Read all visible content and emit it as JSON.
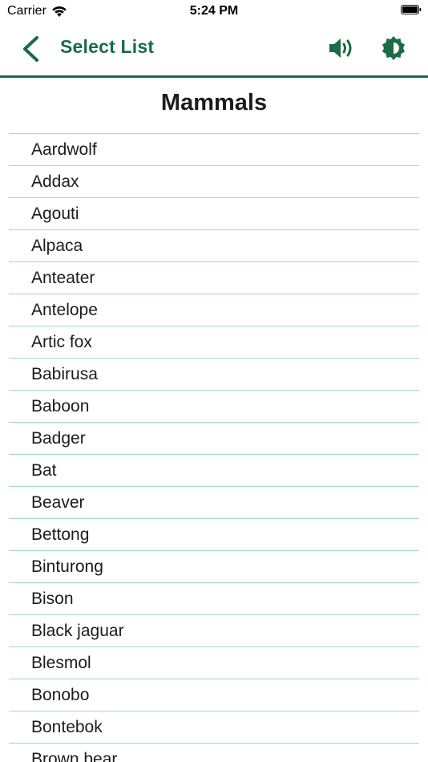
{
  "status_bar": {
    "carrier": "Carrier",
    "time": "5:24 PM"
  },
  "nav": {
    "title": "Select List",
    "back_icon": "chevron-left-icon",
    "speaker_icon": "speaker-icon",
    "theme_icon": "theme-contrast-icon"
  },
  "header": {
    "title": "Mammals"
  },
  "list": {
    "items": [
      "Aardwolf",
      "Addax",
      "Agouti",
      "Alpaca",
      "Anteater",
      "Antelope",
      "Artic fox",
      "Babirusa",
      "Baboon",
      "Badger",
      "Bat",
      "Beaver",
      "Bettong",
      "Binturong",
      "Bison",
      "Black jaguar",
      "Blesmol",
      "Bonobo",
      "Bontebok",
      "Brown bear"
    ]
  },
  "colors": {
    "accent": "#1a6b46",
    "divider": "#9edcb5",
    "text": "#1c1c1e"
  }
}
